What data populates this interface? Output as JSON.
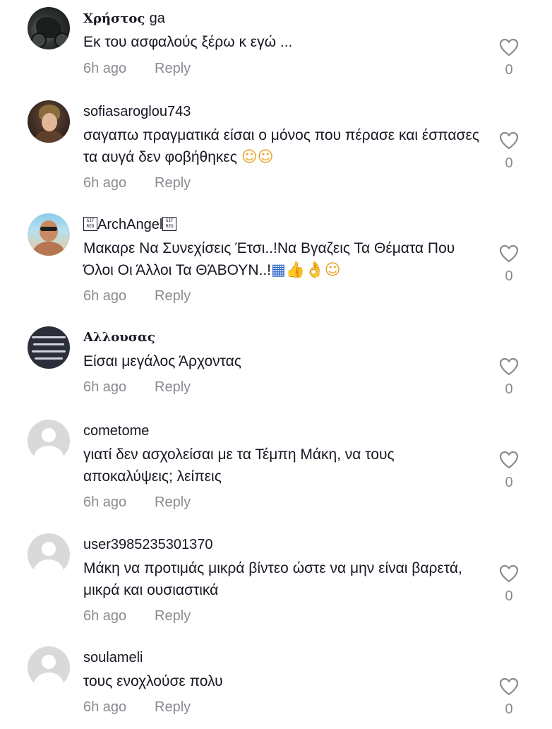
{
  "comments": [
    {
      "username": "Χρήστος",
      "username_suffix": "ga",
      "text": "Εκ του ασφαλούς ξέρω κ εγώ ...",
      "time": "6h ago",
      "reply_label": "Reply",
      "likes": "0"
    },
    {
      "username": "sofiasaroglou743",
      "text": "σαγαπω πραγματικά είσαι ο μόνος που πέρασε και έσπασες τα αυγά δεν φοβήθηκες",
      "emojis": "☺☺",
      "time": "6h ago",
      "reply_label": "Reply",
      "likes": "0"
    },
    {
      "username": "ArchAngel",
      "gif_tag": "GIF RED",
      "text": "Μακαρε Να Συνεχίσεις Έτσι..!Να Βγαζεις Τα Θέματα Που Όλοι Οι Άλλοι Τα ΘΆΒΟΥΝ..!",
      "emojis_flag": "▦",
      "emojis": "👍👌☺",
      "time": "6h ago",
      "reply_label": "Reply",
      "likes": "0"
    },
    {
      "username": "Αλλουσας",
      "text": "Είσαι μεγάλος Άρχοντας",
      "time": "6h ago",
      "reply_label": "Reply",
      "likes": "0"
    },
    {
      "username": "cometome",
      "text": "γιατί δεν ασχολείσαι με τα Τέμπη Μάκη, να τους αποκαλύψεις; λείπεις",
      "time": "6h ago",
      "reply_label": "Reply",
      "likes": "0"
    },
    {
      "username": "user3985235301370",
      "text": "Μάκη να προτιμάς μικρά βίντεο ώστε να μην είναι βαρετά, μικρά και ουσιαστικά",
      "time": "6h ago",
      "reply_label": "Reply",
      "likes": "0"
    },
    {
      "username": "soulameli",
      "text": "τους ενοχλούσε πολυ",
      "time": "6h ago",
      "reply_label": "Reply",
      "likes": "0"
    }
  ],
  "icons": {
    "like": "heart-outline-icon",
    "default_avatar": "default-avatar-icon"
  },
  "colors": {
    "text": "#161823",
    "secondary": "#8a8b91",
    "avatar_placeholder": "#d9d9dc"
  }
}
